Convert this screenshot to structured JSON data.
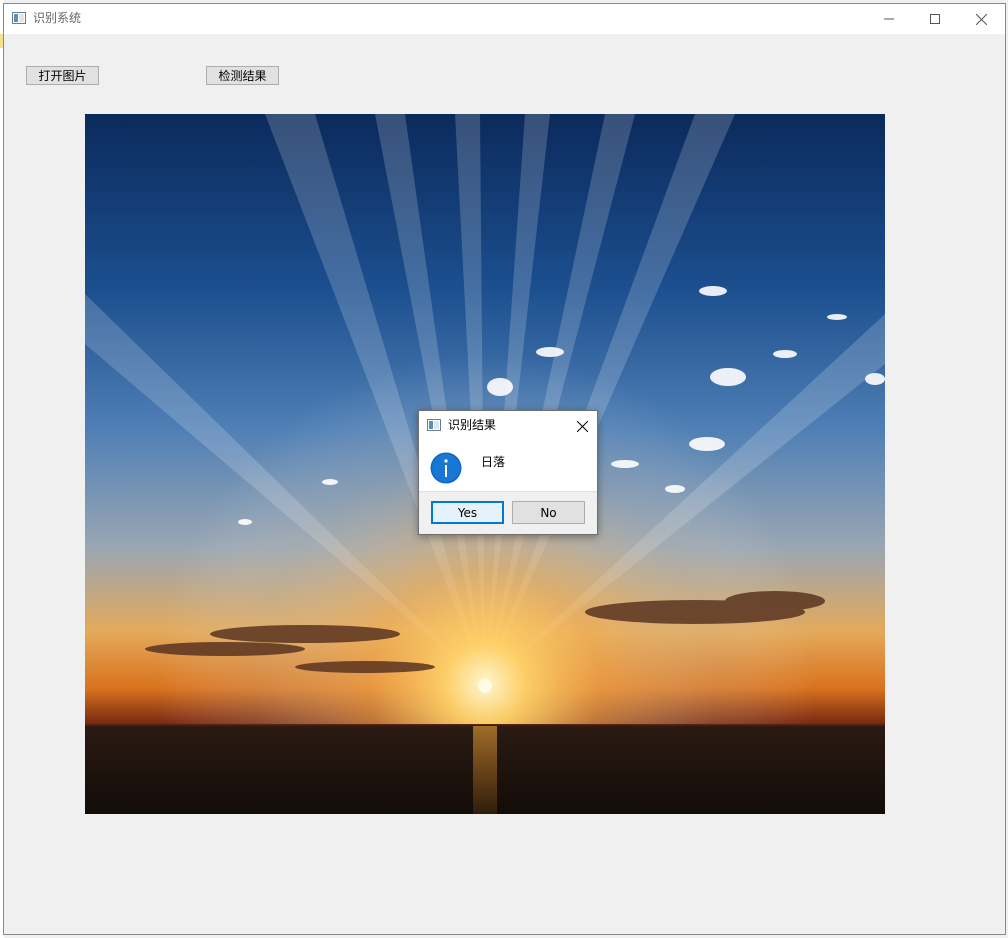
{
  "window": {
    "title": "识别系统",
    "icon": "app-window-icon",
    "controls": [
      "minimize-icon",
      "maximize-icon",
      "close-icon"
    ]
  },
  "toolbar": {
    "open_image_label": "打开图片",
    "detect_result_label": "检测结果"
  },
  "image": {
    "subject": "sunset-over-sea"
  },
  "dialog": {
    "title": "识别结果",
    "message": "日落",
    "icon": "info-icon",
    "yes_label": "Yes",
    "no_label": "No"
  },
  "colors": {
    "accent": "#0078d7",
    "button_bg": "#e1e1e1",
    "button_border": "#adadad",
    "window_bg": "#f0f0f0"
  }
}
